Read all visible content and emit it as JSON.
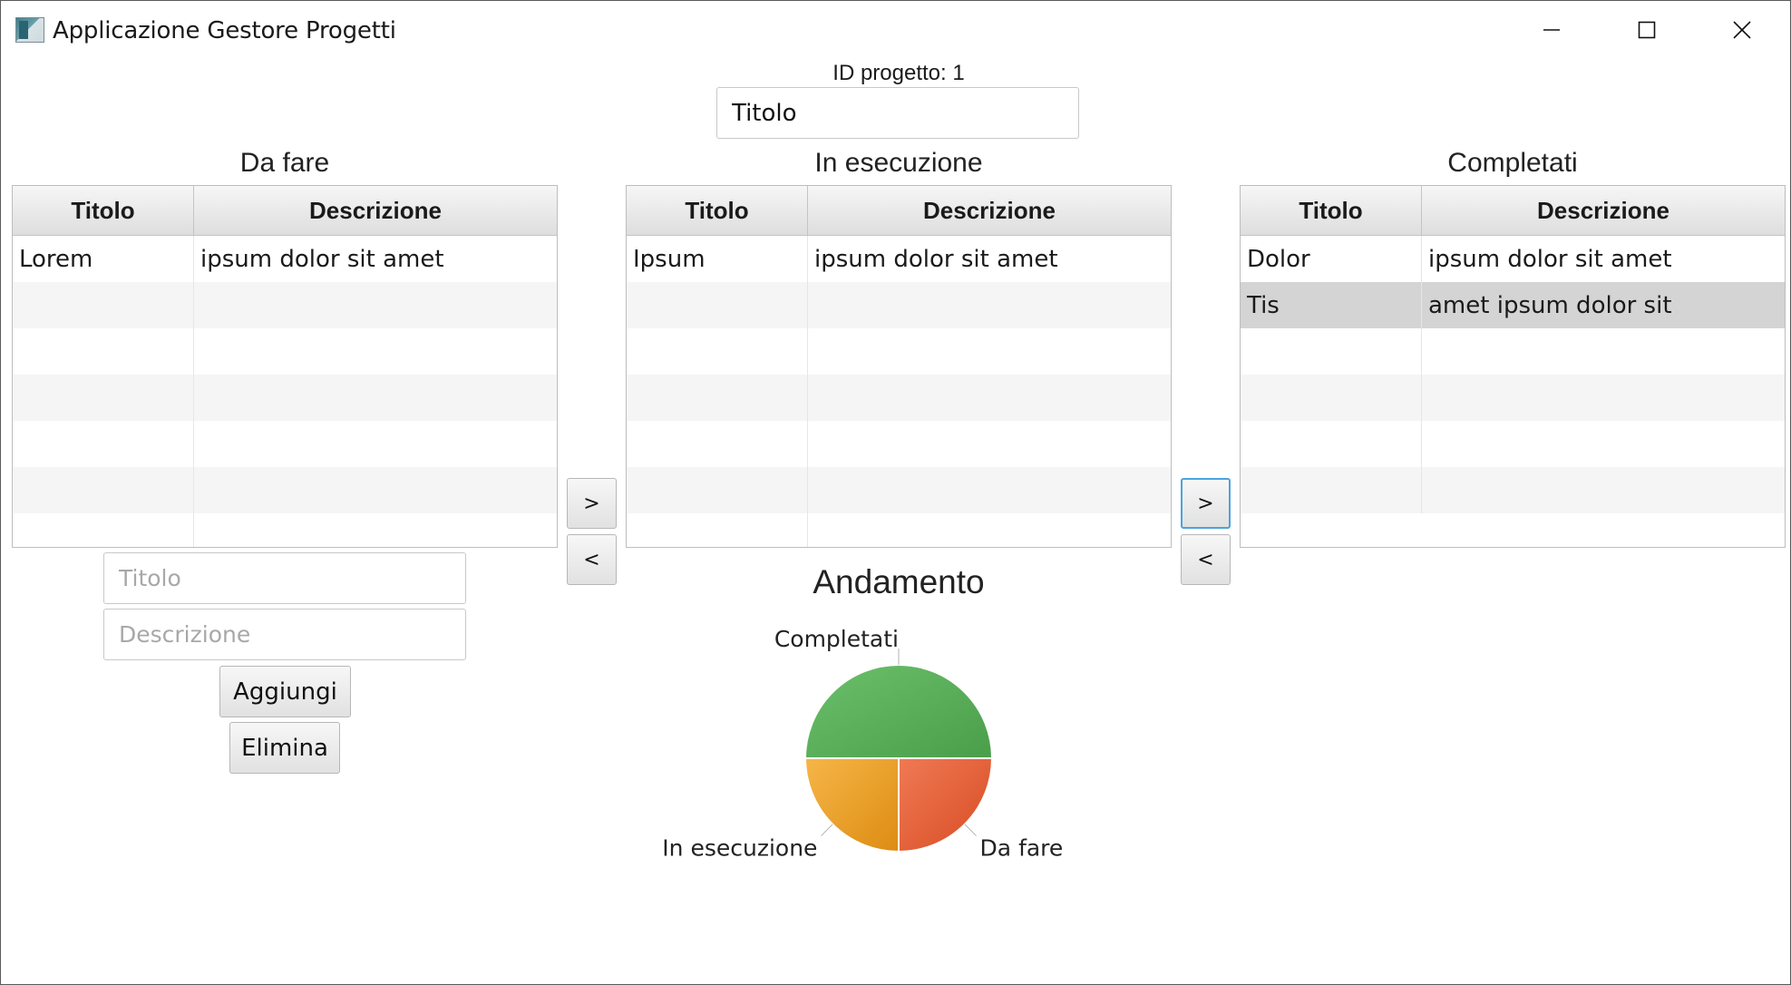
{
  "window": {
    "title": "Applicazione Gestore Progetti",
    "controls": [
      "minimize-icon",
      "maximize-icon",
      "close-icon"
    ]
  },
  "project": {
    "id_label": "ID progetto: 1",
    "title_value": "Titolo"
  },
  "columns": [
    {
      "heading": "Da fare",
      "headers": [
        "Titolo",
        "Descrizione"
      ],
      "rows": [
        {
          "titolo": "Lorem",
          "descrizione": "ipsum dolor sit amet"
        }
      ]
    },
    {
      "heading": "In esecuzione",
      "headers": [
        "Titolo",
        "Descrizione"
      ],
      "rows": [
        {
          "titolo": "Ipsum",
          "descrizione": "ipsum dolor sit amet"
        }
      ]
    },
    {
      "heading": "Completati",
      "headers": [
        "Titolo",
        "Descrizione"
      ],
      "rows": [
        {
          "titolo": "Dolor",
          "descrizione": "ipsum dolor sit amet"
        },
        {
          "titolo": "Tis",
          "descrizione": "amet ipsum dolor sit",
          "selected": true
        }
      ]
    }
  ],
  "move_buttons": {
    "forward_label": ">",
    "back_label": "<"
  },
  "add_form": {
    "titolo_placeholder": "Titolo",
    "descrizione_placeholder": "Descrizione",
    "add_label": "Aggiungi",
    "delete_label": "Elimina"
  },
  "chart_data": {
    "type": "pie",
    "title": "Andamento",
    "labels": [
      "Completati",
      "Da fare",
      "In esecuzione"
    ],
    "values": [
      2,
      1,
      1
    ],
    "colors": [
      "#5bb15b",
      "#e0603a",
      "#eea022"
    ],
    "legend": "none"
  }
}
